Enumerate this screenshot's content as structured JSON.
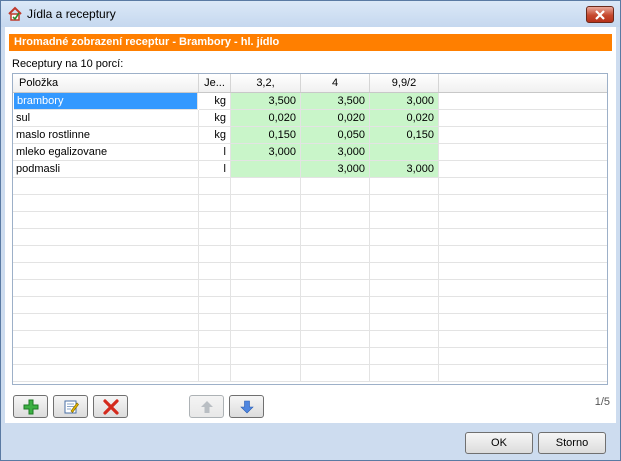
{
  "window": {
    "title": "Jídla a receptury"
  },
  "banner": {
    "text": "Hromadné zobrazení receptur - Brambory - hl. jídlo"
  },
  "caption": {
    "text": "Receptury na 10 porcí:"
  },
  "grid": {
    "headers": [
      "Položka",
      "Je...",
      "3,2,",
      "4",
      "9,9/2"
    ],
    "rows": [
      {
        "name": "brambory",
        "unit": "kg",
        "v1": "3,500",
        "v2": "3,500",
        "v3": "3,000"
      },
      {
        "name": "sul",
        "unit": "kg",
        "v1": "0,020",
        "v2": "0,020",
        "v3": "0,020"
      },
      {
        "name": "maslo rostlinne",
        "unit": "kg",
        "v1": "0,150",
        "v2": "0,050",
        "v3": "0,150"
      },
      {
        "name": "mleko egalizovane",
        "unit": "l",
        "v1": "3,000",
        "v2": "3,000",
        "v3": ""
      },
      {
        "name": "podmasli",
        "unit": "l",
        "v1": "",
        "v2": "3,000",
        "v3": "3,000"
      }
    ]
  },
  "pager": {
    "text": "1/5"
  },
  "buttons": {
    "ok": "OK",
    "cancel": "Storno"
  },
  "icons": {
    "add": "plus-icon",
    "edit": "edit-icon",
    "delete": "delete-icon",
    "up": "arrow-up-icon",
    "down": "arrow-down-icon",
    "close": "close-icon",
    "app": "app-icon"
  },
  "colors": {
    "banner": "#ff7f00",
    "cell_green": "#c9f5c9",
    "selection": "#3399ff"
  }
}
